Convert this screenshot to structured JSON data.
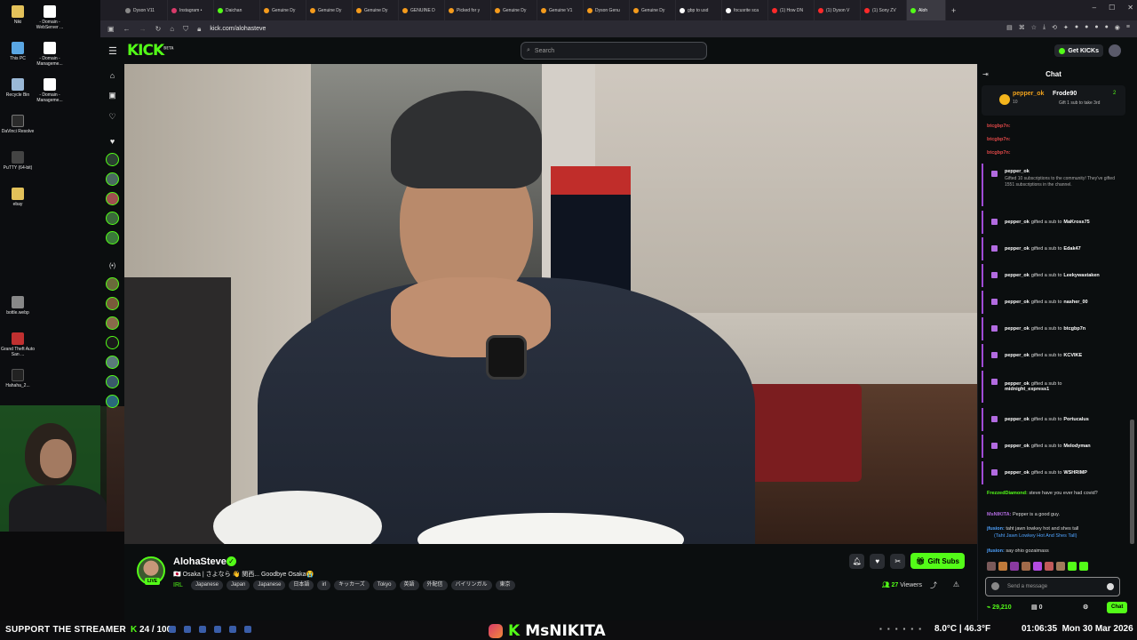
{
  "desktop": {
    "icons": [
      {
        "label": "Niki",
        "color": "#e3c15a"
      },
      {
        "label": "- Domain - WebServer ...",
        "color": "#ffffff"
      },
      {
        "label": "This PC",
        "color": "#5aa6e3"
      },
      {
        "label": "- Domain - Manageme...",
        "color": "#ffffff"
      },
      {
        "label": "Recycle Bin",
        "color": "#9ab8d6"
      },
      {
        "label": "- Domain - Manageme...",
        "color": "#ffffff"
      },
      {
        "label": "DaVinci Resolve",
        "color": "#2b2b2b"
      },
      {
        "label": "PuTTY (64-bit)",
        "color": "#444444"
      },
      {
        "label": "ebay",
        "color": "#e3c15a"
      },
      {
        "label": "bottle.webp",
        "color": "#888888"
      },
      {
        "label": "Grand Theft Auto San ...",
        "color": "#c03030"
      },
      {
        "label": "Hahaha_2...",
        "color": "#222222"
      }
    ]
  },
  "browser": {
    "tabs": [
      {
        "label": "Dyson V11",
        "color": "#888888"
      },
      {
        "label": "Instagram •",
        "color": "#d93a6a"
      },
      {
        "label": "Daichan",
        "color": "#53fc18"
      },
      {
        "label": "Genuine Dy",
        "color": "#f59b1c"
      },
      {
        "label": "Genuine Dy",
        "color": "#f59b1c"
      },
      {
        "label": "Genuine Dy",
        "color": "#f59b1c"
      },
      {
        "label": "GENUINE D",
        "color": "#f59b1c"
      },
      {
        "label": "Picked for y",
        "color": "#f59b1c"
      },
      {
        "label": "Genuine Dy",
        "color": "#f59b1c"
      },
      {
        "label": "Genuine V1",
        "color": "#f59b1c"
      },
      {
        "label": "Dyson Genu",
        "color": "#f59b1c"
      },
      {
        "label": "Genuine Dy",
        "color": "#f59b1c"
      },
      {
        "label": "gbp to usd",
        "color": "#ffffff"
      },
      {
        "label": "focusrite sca",
        "color": "#ffffff"
      },
      {
        "label": "(1) How DN",
        "color": "#ff2a2a"
      },
      {
        "label": "(1) Dyson V",
        "color": "#ff2a2a"
      },
      {
        "label": "(1) Sony ZV",
        "color": "#ff2a2a"
      },
      {
        "label": "Aloh",
        "color": "#53fc18"
      }
    ],
    "url": "kick.com/alohasteve"
  },
  "kick": {
    "logo": "KICK",
    "logo_sup": "BETA",
    "search_placeholder": "Search",
    "get_kicks": "Get KICKs"
  },
  "stream": {
    "streamer": "AlohaSteve",
    "live_badge": "LIVE",
    "title": "🇯🇵 Osaka | さよなら 👋 関西... Goodbye Osaka😭",
    "category": "IRL",
    "tags": [
      "Japanese",
      "Japan",
      "Japanese",
      "日本語",
      "irl",
      "キッカーズ",
      "Tokyo",
      "英語",
      "外配信",
      "バイリンガル",
      "東京"
    ],
    "viewers_count": "27",
    "viewers_label": "Viewers",
    "gift_subs_label": "Gift Subs"
  },
  "chat": {
    "title": "Chat",
    "pinned": {
      "user1": "pepper_ok",
      "count1": "10",
      "user2": "Frode90",
      "count2": "2",
      "caption2": "Gift 1 sub to take 3rd"
    },
    "short_lines": [
      "btcgbp7n:",
      "btcgbp7n:",
      "btcgbp7n:"
    ],
    "community_gift": {
      "user": "pepper_ok",
      "text": "Gifted 10 subscriptions to the community! They've gifted 1551 subscriptions in the channel."
    },
    "gifts": [
      {
        "user": "pepper_ok",
        "action": "gifted a sub to",
        "recipient": "MaKross75"
      },
      {
        "user": "pepper_ok",
        "action": "gifted a sub to",
        "recipient": "Edak47"
      },
      {
        "user": "pepper_ok",
        "action": "gifted a sub to",
        "recipient": "Leekywastaken"
      },
      {
        "user": "pepper_ok",
        "action": "gifted a sub to",
        "recipient": "nasher_00"
      },
      {
        "user": "pepper_ok",
        "action": "gifted a sub to",
        "recipient": "btcgbp7n"
      },
      {
        "user": "pepper_ok",
        "action": "gifted a sub to",
        "recipient": "KCVIKE"
      },
      {
        "user": "pepper_ok",
        "action": "gifted a sub to",
        "recipient": "midnight_express1"
      },
      {
        "user": "pepper_ok",
        "action": "gifted a sub to",
        "recipient": "Portucalus"
      },
      {
        "user": "pepper_ok",
        "action": "gifted a sub to",
        "recipient": "Melodyman"
      },
      {
        "user": "pepper_ok",
        "action": "gifted a sub to",
        "recipient": "WSHRIMP"
      }
    ],
    "messages": [
      {
        "user": "FrezzedDiamond:",
        "text": "steve have you ever had covid?",
        "color": "#53fc18"
      },
      {
        "user": "MsNIKITA:",
        "text": "Pepper is a good guy.",
        "color": "#b26be0"
      },
      {
        "user": "jfusion:",
        "text": "taht jawn lowkey hot and shes tall",
        "color": "#4fa3ff"
      },
      {
        "user": "",
        "text": "(Taht Jawn Lowkey Hot And Shes Tall)",
        "color": "#4fa3ff"
      },
      {
        "user": "jfusion:",
        "text": "say ohio gozaimass",
        "color": "#4fa3ff"
      }
    ],
    "input_placeholder": "Send a message",
    "kicks_balance": "29,210",
    "box_count": "0",
    "send_label": "Chat"
  },
  "taskbar": {
    "support_text": "SUPPORT THE STREAMER",
    "counter_a": "24",
    "counter_b": "100",
    "brand": "MsNIKITA",
    "weather": "8.0°C | 46.3°F",
    "time": "01:06:35",
    "date": "Mon 30 Mar 2026"
  }
}
